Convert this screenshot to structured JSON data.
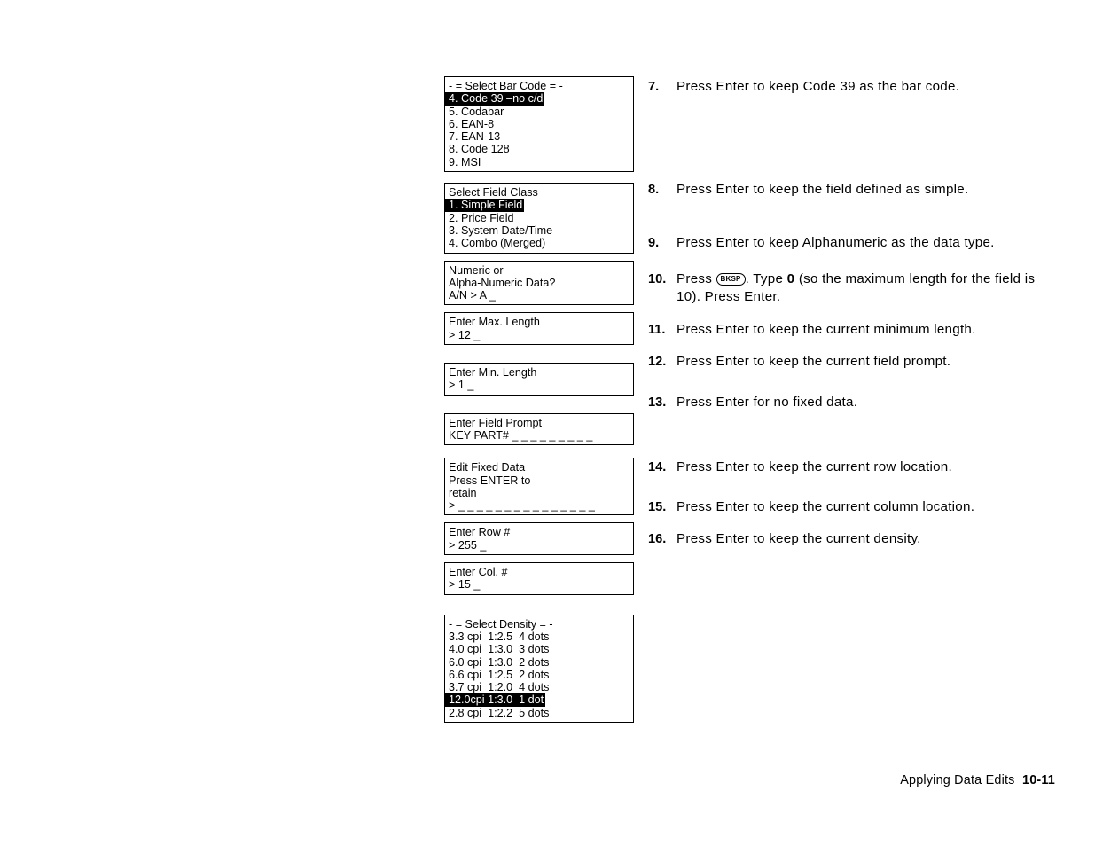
{
  "screens": [
    {
      "name": "select-bar-code",
      "lines": [
        {
          "text": "- = Select Bar Code = -",
          "highlight": false
        },
        {
          "text": "4. Code 39 –no c/d",
          "highlight": true
        },
        {
          "text": "5. Codabar",
          "highlight": false
        },
        {
          "text": "6. EAN-8",
          "highlight": false
        },
        {
          "text": "7. EAN-13",
          "highlight": false
        },
        {
          "text": "8. Code 128",
          "highlight": false
        },
        {
          "text": "9. MSI",
          "highlight": false
        }
      ]
    },
    {
      "name": "select-field-class",
      "lines": [
        {
          "text": "Select Field Class",
          "highlight": false
        },
        {
          "text": "1. Simple Field",
          "highlight": true
        },
        {
          "text": "2. Price Field",
          "highlight": false
        },
        {
          "text": "3. System Date/Time",
          "highlight": false
        },
        {
          "text": "4. Combo (Merged)",
          "highlight": false
        }
      ]
    },
    {
      "name": "numeric-or-alpha-numeric",
      "lines": [
        {
          "text": "Numeric or",
          "highlight": false
        },
        {
          "text": "Alpha-Numeric Data?",
          "highlight": false
        },
        {
          "text": "A/N > A _",
          "highlight": false
        }
      ]
    },
    {
      "name": "enter-max-length",
      "lines": [
        {
          "text": "Enter Max. Length",
          "highlight": false
        },
        {
          "text": "> 12 _",
          "highlight": false
        }
      ]
    },
    {
      "name": "enter-min-length",
      "lines": [
        {
          "text": "Enter Min. Length",
          "highlight": false
        },
        {
          "text": "> 1 _",
          "highlight": false
        }
      ]
    },
    {
      "name": "enter-field-prompt",
      "lines": [
        {
          "text": "Enter Field Prompt",
          "highlight": false
        },
        {
          "text": "KEY PART# _ _ _ _ _ _ _ _ _",
          "highlight": false
        }
      ]
    },
    {
      "name": "edit-fixed-data",
      "lines": [
        {
          "text": "Edit Fixed Data",
          "highlight": false
        },
        {
          "text": "Press ENTER to",
          "highlight": false
        },
        {
          "text": "retain",
          "highlight": false
        },
        {
          "text": "> _ _ _ _ _ _ _ _ _ _ _ _ _ _ _",
          "highlight": false
        }
      ]
    },
    {
      "name": "enter-row-number",
      "lines": [
        {
          "text": "Enter Row #",
          "highlight": false
        },
        {
          "text": "> 255 _",
          "highlight": false
        }
      ]
    },
    {
      "name": "enter-col-number",
      "lines": [
        {
          "text": "Enter Col. #",
          "highlight": false
        },
        {
          "text": "> 15 _",
          "highlight": false
        }
      ]
    },
    {
      "name": "select-density",
      "lines": [
        {
          "text": "- = Select Density = -",
          "highlight": false
        },
        {
          "text": "3.3 cpi  1:2.5  4 dots",
          "highlight": false
        },
        {
          "text": "4.0 cpi  1:3.0  3 dots",
          "highlight": false
        },
        {
          "text": "6.0 cpi  1:3.0  2 dots",
          "highlight": false
        },
        {
          "text": "6.6 cpi  1:2.5  2 dots",
          "highlight": false
        },
        {
          "text": "3.7 cpi  1:2.0  4 dots",
          "highlight": false
        },
        {
          "text": "12.0cpi 1:3.0  1 dot",
          "highlight": true
        },
        {
          "text": "2.8 cpi  1:2.2  5 dots",
          "highlight": false
        }
      ]
    }
  ],
  "steps": [
    {
      "number": "7.",
      "text": "Press Enter to keep Code 39 as the bar code."
    },
    {
      "number": "8.",
      "text": "Press Enter to keep the field defined as simple."
    },
    {
      "number": "9.",
      "text": "Press Enter to keep Alphanumeric as the data type."
    },
    {
      "number": "10.",
      "prefix": "Press ",
      "key": "BKSP",
      "middle": ".  Type ",
      "bold": "0",
      "suffix": " (so the maximum length for the field is 10).  Press Enter."
    },
    {
      "number": "11.",
      "text": "Press Enter to keep the current minimum length."
    },
    {
      "number": "12.",
      "text": "Press Enter to keep the current field prompt."
    },
    {
      "number": "13.",
      "text": "Press Enter for no fixed data."
    },
    {
      "number": "14.",
      "text": "Press Enter to keep the current row location."
    },
    {
      "number": "15.",
      "text": "Press Enter to keep the current column location."
    },
    {
      "number": "16.",
      "text": "Press Enter to keep the current density."
    }
  ],
  "footer": {
    "title": "Applying Data Edits",
    "page": "10-11"
  }
}
